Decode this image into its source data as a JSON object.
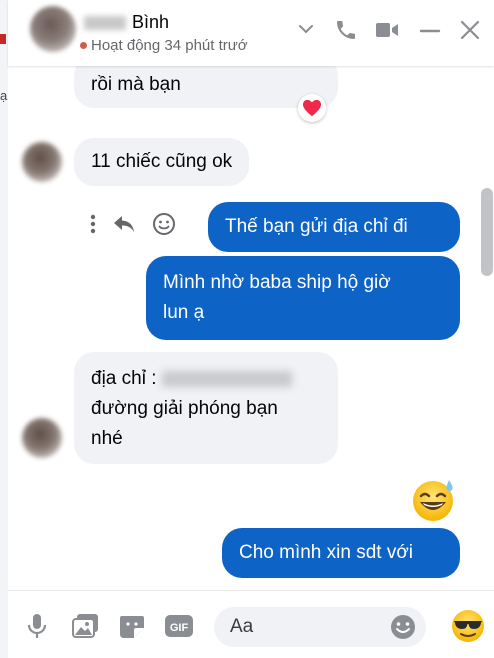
{
  "header": {
    "name": "Bình",
    "status": "Hoạt động 34 phút trướ"
  },
  "background": {
    "fragment": "ạ"
  },
  "messages": [
    {
      "side": "in",
      "text": "rồi mà bạn",
      "reaction": "heart"
    },
    {
      "side": "in",
      "text": "11 chiếc cũng ok"
    },
    {
      "side": "out",
      "text": "Thế bạn gửi địa chỉ đi"
    },
    {
      "side": "out",
      "lines": [
        "Mình nhờ baba ship hộ giờ",
        "lun ạ"
      ]
    },
    {
      "side": "in",
      "lines": [
        "địa chỉ :",
        "đường giải phóng bạn",
        "nhé"
      ]
    },
    {
      "side": "out",
      "emoji": "sweat-smile"
    },
    {
      "side": "out",
      "text": "Cho mình xin sdt với"
    }
  ],
  "composer": {
    "placeholder": "Aa"
  },
  "colors": {
    "accent": "#0d63c6",
    "incoming_bubble": "#f0f2f5",
    "icon": "#0a7cff",
    "heart": "#f02849"
  }
}
